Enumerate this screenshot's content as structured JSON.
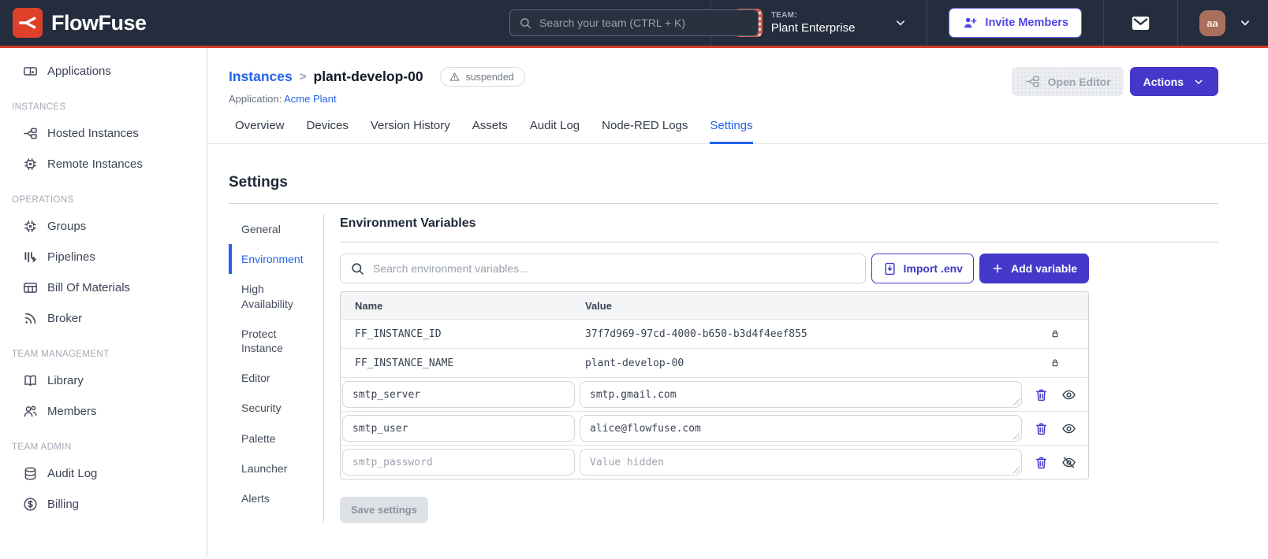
{
  "brand": {
    "name": "FlowFuse"
  },
  "header": {
    "search_placeholder": "Search your team (CTRL + K)",
    "team_label": "TEAM:",
    "team_name": "Plant Enterprise",
    "invite_label": "Invite Members",
    "avatar_initials": "aa"
  },
  "sidebar": {
    "headings": {
      "instances": "INSTANCES",
      "operations": "OPERATIONS",
      "team_management": "TEAM MANAGEMENT",
      "team_admin": "TEAM ADMIN"
    },
    "items": {
      "applications": "Applications",
      "hosted": "Hosted Instances",
      "remote": "Remote Instances",
      "groups": "Groups",
      "pipelines": "Pipelines",
      "bom": "Bill Of Materials",
      "broker": "Broker",
      "library": "Library",
      "members": "Members",
      "audit": "Audit Log",
      "billing": "Billing"
    }
  },
  "page": {
    "breadcrumb": {
      "parent": "Instances",
      "separator": ">",
      "current": "plant-develop-00"
    },
    "status_badge": "suspended",
    "application_label": "Application:",
    "application_name": "Acme Plant",
    "open_editor_label": "Open Editor",
    "actions_label": "Actions"
  },
  "tabs": [
    {
      "label": "Overview"
    },
    {
      "label": "Devices"
    },
    {
      "label": "Version History"
    },
    {
      "label": "Assets"
    },
    {
      "label": "Audit Log"
    },
    {
      "label": "Node-RED Logs"
    },
    {
      "label": "Settings",
      "active": true
    }
  ],
  "settings": {
    "title": "Settings",
    "nav": [
      {
        "label": "General"
      },
      {
        "label": "Environment",
        "active": true
      },
      {
        "label": "High Availability"
      },
      {
        "label": "Protect Instance"
      },
      {
        "label": "Editor"
      },
      {
        "label": "Security"
      },
      {
        "label": "Palette"
      },
      {
        "label": "Launcher"
      },
      {
        "label": "Alerts"
      }
    ],
    "env": {
      "section_title": "Environment Variables",
      "search_placeholder": "Search environment variables...",
      "import_label": "Import .env",
      "add_label": "Add variable",
      "columns": {
        "name": "Name",
        "value": "Value"
      },
      "locked_rows": [
        {
          "name": "FF_INSTANCE_ID",
          "value": "37f7d969-97cd-4000-b650-b3d4f4eef855"
        },
        {
          "name": "FF_INSTANCE_NAME",
          "value": "plant-develop-00"
        }
      ],
      "editable_rows": [
        {
          "name": "smtp_server",
          "value": "smtp.gmail.com"
        },
        {
          "name": "smtp_user",
          "value": "alice@flowfuse.com"
        },
        {
          "name": "smtp_password",
          "value": "",
          "value_placeholder": "Value hidden"
        }
      ],
      "save_label": "Save settings"
    }
  },
  "colors": {
    "header_bg": "#232d3d",
    "brand_red": "#df4029",
    "accent_blue": "#2563eb",
    "primary_indigo": "#4338ca",
    "team_avatar_orange": "#d95f45",
    "user_avatar_brown": "#a9705b"
  }
}
